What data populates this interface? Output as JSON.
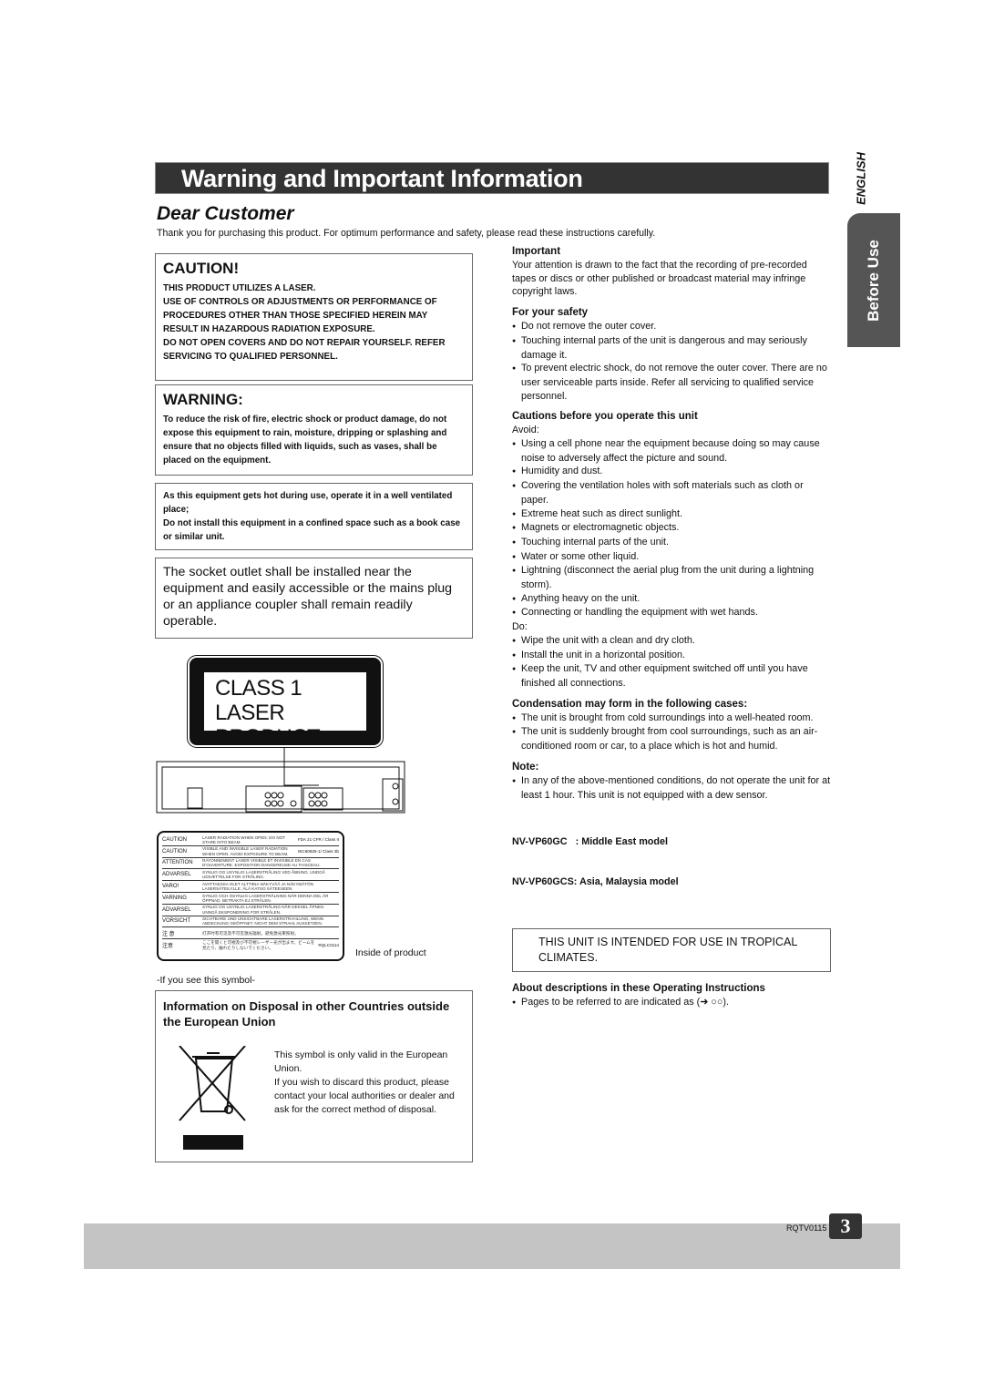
{
  "header": {
    "title": "Warning and Important Information",
    "subtitle": "Dear Customer",
    "intro": "Thank you for purchasing this product. For optimum performance and safety, please read these instructions carefully.",
    "language": "ENGLISH",
    "section_tab": "Before Use"
  },
  "caution": {
    "heading": "CAUTION!",
    "lines": [
      "THIS PRODUCT UTILIZES A LASER.",
      "USE OF CONTROLS OR ADJUSTMENTS OR PERFORMANCE OF PROCEDURES OTHER THAN THOSE SPECIFIED HEREIN MAY RESULT IN HAZARDOUS RADIATION EXPOSURE.",
      "DO NOT OPEN COVERS AND DO NOT REPAIR YOURSELF. REFER SERVICING TO QUALIFIED PERSONNEL."
    ]
  },
  "warning": {
    "heading": "WARNING:",
    "text": "To reduce the risk of fire, electric shock or product damage, do not expose this equipment to rain, moisture, dripping or splashing and ensure that no objects filled with liquids, such as vases, shall be placed on the equipment."
  },
  "ventilation": {
    "lines": [
      "As this equipment gets hot during use, operate it in a well ventilated place;",
      "Do not install this equipment in a confined space such as a book case or similar unit."
    ]
  },
  "socket": {
    "text": "The socket outlet shall be installed near the equipment and easily accessible or the mains plug or an appliance coupler shall remain readily operable."
  },
  "laser_label": {
    "line1": "CLASS 1",
    "line2": "LASER PRODUCT"
  },
  "inside_label": {
    "rows": [
      {
        "k": "CAUTION",
        "v": "LASER RADIATION WHEN OPEN. DO NOT STARE INTO BEAM.",
        "r": "FDA 21 CFR / Class II"
      },
      {
        "k": "CAUTION",
        "v": "VISIBLE AND INVISIBLE LASER RADIATION WHEN OPEN. AVOID EXPOSURE TO BEAM.",
        "r": "IEC60825-1/ Class 3b"
      },
      {
        "k": "ATTENTION",
        "v": "RAYONNEMENT LASER VISIBLE ET INVISIBLE EN CAS D'OUVERTURE. EXPOSITION DANGEREUSE AU FAISCEAU.",
        "r": ""
      },
      {
        "k": "ADVARSEL",
        "v": "SYNLIG OG USYNLIG LASERSTRÅLING VED ÅBNING. UNDGÅ UDSÆTTELSE FOR STRÅLING.",
        "r": ""
      },
      {
        "k": "VARO!",
        "v": "AVATTAESSA OLET ALTTIINA NÄKYVÄÄ JA NÄKYMÄTÖN LASERSÄTEILYLLE. ÄLÄ KATSO SÄTEESEEN.",
        "r": ""
      },
      {
        "k": "VARNING",
        "v": "SYNLIG OCH OSYNLIG LASERSTRÅLNING NÄR DENNA DEL ÄR ÖPPNAD. BETRAKTA EJ STRÅLEN.",
        "r": ""
      },
      {
        "k": "ADVARSEL",
        "v": "SYNLIG OG USYNLIG LASERSTRÅLING NÅR DEKSEL ÅPNES. UNNGÅ EKSPONERING FOR STRÅLEN.",
        "r": ""
      },
      {
        "k": "VORSICHT",
        "v": "SICHTBARE UND UNSICHTBARE LASERSTRAHLUNG, WENN ABDECKUNG GEÖFFNET. NICHT DEM STRAHL AUSSETZEN.",
        "r": ""
      },
      {
        "k": "注 意",
        "v": "打开时有可见及不可见激光辐射。避免激光束照射。",
        "r": ""
      },
      {
        "k": "注意",
        "v": "ここを開くと可視及び不可視レーザー光が出ます。ビームを見たり、触れたりしないでください。",
        "r": "RQLC0114"
      }
    ],
    "caption": "Inside of product"
  },
  "symbol_note": "-If you see this symbol-",
  "disposal": {
    "heading": "Information on Disposal in other Countries outside the European Union",
    "text1": "This symbol is only valid in the European Union.",
    "text2": "If you wish to discard this product, please contact your local authorities or dealer and ask for the correct method of disposal."
  },
  "important": {
    "heading": "Important",
    "text": "Your attention is drawn to the fact that the recording of pre-recorded tapes or discs or other published or broadcast material may infringe copyright laws."
  },
  "safety": {
    "heading": "For your safety",
    "items": [
      "Do not remove the outer cover.",
      "Touching internal parts of the unit is dangerous and may seriously damage it.",
      "To prevent electric shock, do not remove the outer cover. There are no user serviceable parts inside. Refer all servicing to qualified service personnel."
    ]
  },
  "cautions": {
    "heading": "Cautions before you operate this unit",
    "avoid_label": "Avoid:",
    "avoid": [
      "Using a cell phone near the equipment because doing so may cause noise to adversely affect the picture and sound.",
      "Humidity and dust.",
      "Covering the ventilation holes with soft materials such as cloth or paper.",
      "Extreme heat such as direct sunlight.",
      "Magnets or electromagnetic objects.",
      "Touching internal parts of the unit.",
      "Water or some other liquid.",
      "Lightning (disconnect the aerial plug from the unit during a lightning storm).",
      "Anything heavy on the unit.",
      "Connecting or handling the equipment with wet hands."
    ],
    "do_label": "Do:",
    "do": [
      "Wipe the unit with a clean and dry cloth.",
      "Install the unit in a horizontal position.",
      "Keep the unit, TV and other equipment switched off until you have finished all connections."
    ]
  },
  "condensation": {
    "heading": "Condensation may form in the following cases:",
    "items": [
      "The unit is brought from cold surroundings into a well-heated room.",
      "The unit is suddenly brought from cool surroundings, such as an air-conditioned room or car, to a place which is hot and humid."
    ]
  },
  "note": {
    "heading": "Note:",
    "items": [
      "In any of the above-mentioned conditions, do not operate the unit for at least 1 hour. This unit is not equipped with a dew sensor."
    ]
  },
  "models": [
    "NV-VP60GC   : Middle East model",
    "NV-VP60GCS: Asia, Malaysia model"
  ],
  "tropical": "THIS UNIT IS INTENDED FOR USE IN TROPICAL CLIMATES.",
  "about": {
    "heading": "About descriptions in these Operating Instructions",
    "items": [
      "Pages to be referred to are indicated as (➜ ○○)."
    ]
  },
  "footer": {
    "code": "RQTV0115",
    "page": "3"
  }
}
